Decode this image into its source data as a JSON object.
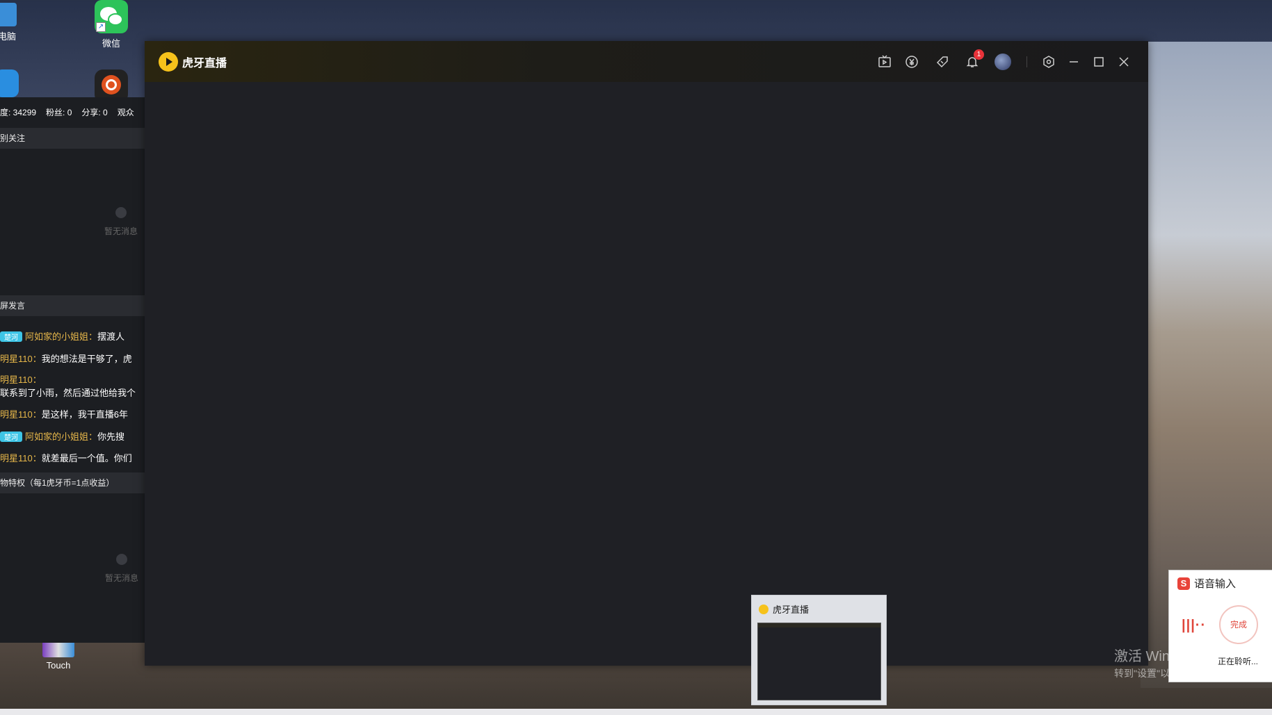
{
  "desktop": {
    "icons": [
      {
        "label": "电脑"
      },
      {
        "label": "微信"
      },
      {
        "label": "Touch"
      }
    ]
  },
  "left_panel": {
    "stats": [
      "度: 34299",
      "粉丝: 0",
      "分享: 0",
      "观众"
    ],
    "section_follow": "别关注",
    "empty_text": "暂无消息",
    "section_chat": "屏发言",
    "chat": [
      {
        "badge": "楚河",
        "nick": "阿如家的小姐姐：",
        "text": "摆渡人"
      },
      {
        "badge": "",
        "nick": "明星110：",
        "text": "我的想法是干够了，虎"
      },
      {
        "badge": "",
        "nick": "明星110：",
        "text": ""
      },
      {
        "badge": "",
        "nick": "",
        "text": "联系到了小雨，然后通过他给我个"
      },
      {
        "badge": "",
        "nick": "明星110：",
        "text": "是这样，我干直播6年"
      },
      {
        "badge": "楚河",
        "nick": "阿如家的小姐姐：",
        "text": "你先搜"
      },
      {
        "badge": "",
        "nick": "明星110：",
        "text": "就差最后一个值。你们"
      }
    ],
    "section_gift": "物特权（每1虎牙币=1点收益）",
    "empty_text2": "暂无消息"
  },
  "window": {
    "title": "虎牙直播",
    "notification_count": "1",
    "icons": [
      "tv-icon",
      "currency-icon",
      "ticket-icon",
      "bell-icon",
      "avatar",
      "settings-icon",
      "minimize-icon",
      "maximize-icon",
      "close-icon"
    ]
  },
  "thumbnail": {
    "title": "虎牙直播"
  },
  "voice_input": {
    "title": "语音输入",
    "button": "完成",
    "status": "正在聆听..."
  },
  "activation": {
    "line1": "激活 Windows",
    "line2": "转到\"设置\"以激活 Windows。"
  },
  "colors": {
    "accent_yellow": "#f6c21b",
    "badge_red": "#e8333a",
    "chat_nick": "#e8b84a",
    "chat_badge": "#3ec5e6"
  }
}
